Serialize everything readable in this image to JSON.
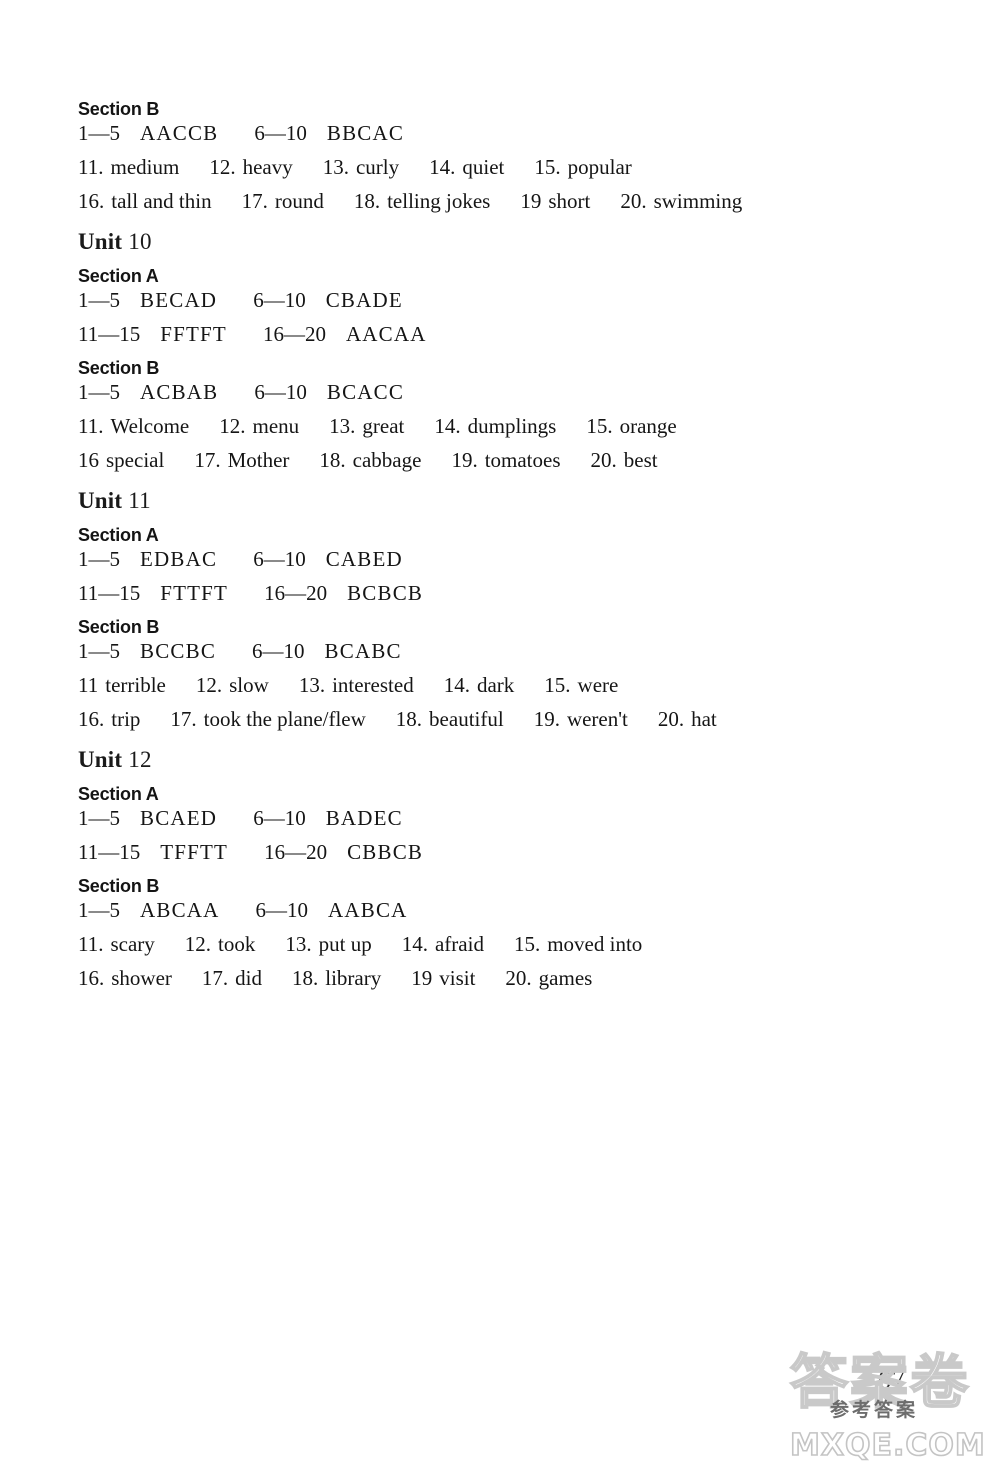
{
  "page": {
    "page_number": "67",
    "background_color": "#ffffff",
    "text_color": "#151515"
  },
  "watermark": {
    "main": "答案卷",
    "subtitle": "参考答案",
    "site": "MXQE.COM",
    "stroke_color": "#c9c9c9"
  },
  "blocks": [
    {
      "kind": "section",
      "heading": "Section B",
      "lines": [
        {
          "kind": "ranges",
          "segments": [
            {
              "range": "1—5",
              "keys": "AACCB"
            },
            {
              "range": "6—10",
              "keys": "BBCAC"
            }
          ]
        },
        {
          "kind": "items",
          "items": [
            {
              "n": "11.",
              "text": "medium"
            },
            {
              "n": "12.",
              "text": "heavy"
            },
            {
              "n": "13.",
              "text": "curly"
            },
            {
              "n": "14.",
              "text": "quiet"
            },
            {
              "n": "15.",
              "text": "popular"
            }
          ]
        },
        {
          "kind": "items",
          "items": [
            {
              "n": "16.",
              "text": "tall and thin"
            },
            {
              "n": "17.",
              "text": "round"
            },
            {
              "n": "18.",
              "text": "telling jokes"
            },
            {
              "n": "19",
              "text": "short"
            },
            {
              "n": "20.",
              "text": "swimming"
            }
          ]
        }
      ]
    },
    {
      "kind": "unit",
      "unit_word": "Unit",
      "unit_number": "10"
    },
    {
      "kind": "section",
      "heading": "Section A",
      "lines": [
        {
          "kind": "ranges",
          "segments": [
            {
              "range": "1—5",
              "keys": "BECAD"
            },
            {
              "range": "6—10",
              "keys": "CBADE"
            }
          ]
        },
        {
          "kind": "ranges",
          "segments": [
            {
              "range": "11—15",
              "keys": "FFTFT"
            },
            {
              "range": "16—20",
              "keys": "AACAA"
            }
          ]
        }
      ]
    },
    {
      "kind": "section",
      "heading": "Section B",
      "lines": [
        {
          "kind": "ranges",
          "segments": [
            {
              "range": "1—5",
              "keys": "ACBAB"
            },
            {
              "range": "6—10",
              "keys": "BCACC"
            }
          ]
        },
        {
          "kind": "items",
          "items": [
            {
              "n": "11.",
              "text": "Welcome"
            },
            {
              "n": "12.",
              "text": "menu"
            },
            {
              "n": "13.",
              "text": "great"
            },
            {
              "n": "14.",
              "text": "dumplings"
            },
            {
              "n": "15.",
              "text": "orange"
            }
          ]
        },
        {
          "kind": "items",
          "items": [
            {
              "n": "16",
              "text": "special"
            },
            {
              "n": "17.",
              "text": "Mother"
            },
            {
              "n": "18.",
              "text": "cabbage"
            },
            {
              "n": "19.",
              "text": "tomatoes"
            },
            {
              "n": "20.",
              "text": "best"
            }
          ]
        }
      ]
    },
    {
      "kind": "unit",
      "unit_word": "Unit",
      "unit_number": "11"
    },
    {
      "kind": "section",
      "heading": "Section A",
      "lines": [
        {
          "kind": "ranges",
          "segments": [
            {
              "range": "1—5",
              "keys": "EDBAC"
            },
            {
              "range": "6—10",
              "keys": "CABED"
            }
          ]
        },
        {
          "kind": "ranges",
          "segments": [
            {
              "range": "11—15",
              "keys": "FTTFT"
            },
            {
              "range": "16—20",
              "keys": "BCBCB"
            }
          ]
        }
      ]
    },
    {
      "kind": "section",
      "heading": "Section B",
      "lines": [
        {
          "kind": "ranges",
          "segments": [
            {
              "range": "1—5",
              "keys": "BCCBC"
            },
            {
              "range": "6—10",
              "keys": "BCABC"
            }
          ]
        },
        {
          "kind": "items",
          "items": [
            {
              "n": "11",
              "text": "terrible"
            },
            {
              "n": "12.",
              "text": "slow"
            },
            {
              "n": "13.",
              "text": "interested"
            },
            {
              "n": "14.",
              "text": "dark"
            },
            {
              "n": "15.",
              "text": "were"
            }
          ]
        },
        {
          "kind": "items",
          "items": [
            {
              "n": "16.",
              "text": "trip"
            },
            {
              "n": "17.",
              "text": "took the plane/flew"
            },
            {
              "n": "18.",
              "text": "beautiful"
            },
            {
              "n": "19.",
              "text": "weren't"
            },
            {
              "n": "20.",
              "text": "hat"
            }
          ]
        }
      ]
    },
    {
      "kind": "unit",
      "unit_word": "Unit",
      "unit_number": "12"
    },
    {
      "kind": "section",
      "heading": "Section A",
      "lines": [
        {
          "kind": "ranges",
          "segments": [
            {
              "range": "1—5",
              "keys": "BCAED"
            },
            {
              "range": "6—10",
              "keys": "BADEC"
            }
          ]
        },
        {
          "kind": "ranges",
          "segments": [
            {
              "range": "11—15",
              "keys": "TFFTT"
            },
            {
              "range": "16—20",
              "keys": "CBBCB"
            }
          ]
        }
      ]
    },
    {
      "kind": "section",
      "heading": "Section B",
      "lines": [
        {
          "kind": "ranges",
          "segments": [
            {
              "range": "1—5",
              "keys": "ABCAA"
            },
            {
              "range": "6—10",
              "keys": "AABCA"
            }
          ]
        },
        {
          "kind": "items",
          "items": [
            {
              "n": "11.",
              "text": "scary"
            },
            {
              "n": "12.",
              "text": "took"
            },
            {
              "n": "13.",
              "text": "put up"
            },
            {
              "n": "14.",
              "text": "afraid"
            },
            {
              "n": "15.",
              "text": "moved into"
            }
          ]
        },
        {
          "kind": "items",
          "items": [
            {
              "n": "16.",
              "text": "shower"
            },
            {
              "n": "17.",
              "text": "did"
            },
            {
              "n": "18.",
              "text": "library"
            },
            {
              "n": "19",
              "text": "visit"
            },
            {
              "n": "20.",
              "text": "games"
            }
          ]
        }
      ]
    }
  ]
}
